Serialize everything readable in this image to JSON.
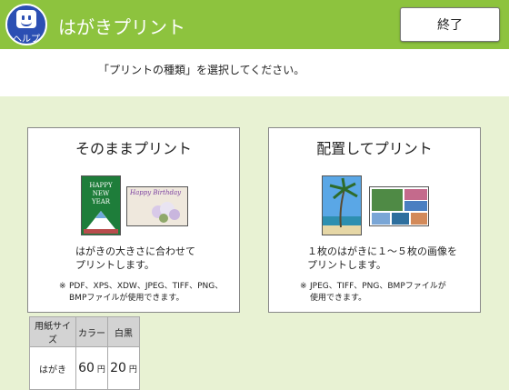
{
  "header": {
    "help_label": "ヘルプ",
    "title": "はがきプリント",
    "end_label": "終了"
  },
  "instruction": "「プリントの種類」を選択してください。",
  "cards": [
    {
      "title": "そのままプリント",
      "desc_line1": "はがきの大きさに合わせて",
      "desc_line2": "プリントします。",
      "note_mark": "※",
      "note_line1": "PDF、XPS、XDW、JPEG、TIFF、PNG、",
      "note_line2": "BMPファイルが使用できます。",
      "thumb1_lines": [
        "HAPPY",
        "NEW",
        "YEAR"
      ],
      "thumb2_text": "Happy Birthday"
    },
    {
      "title": "配置してプリント",
      "desc_line1": "１枚のはがきに１～５枚の画像を",
      "desc_line2": "プリントします。",
      "note_mark": "※",
      "note_line1": "JPEG、TIFF、PNG、BMPファイルが",
      "note_line2": "使用できます。"
    }
  ],
  "price_table": {
    "headers": [
      "用紙サイズ",
      "カラー",
      "白黒"
    ],
    "row": {
      "size": "はがき",
      "color_price": "60",
      "bw_price": "20",
      "unit": "円"
    }
  },
  "colors": {
    "header_green": "#8dc33e",
    "help_blue": "#2b4fb3",
    "background": "#e8f2d3"
  }
}
